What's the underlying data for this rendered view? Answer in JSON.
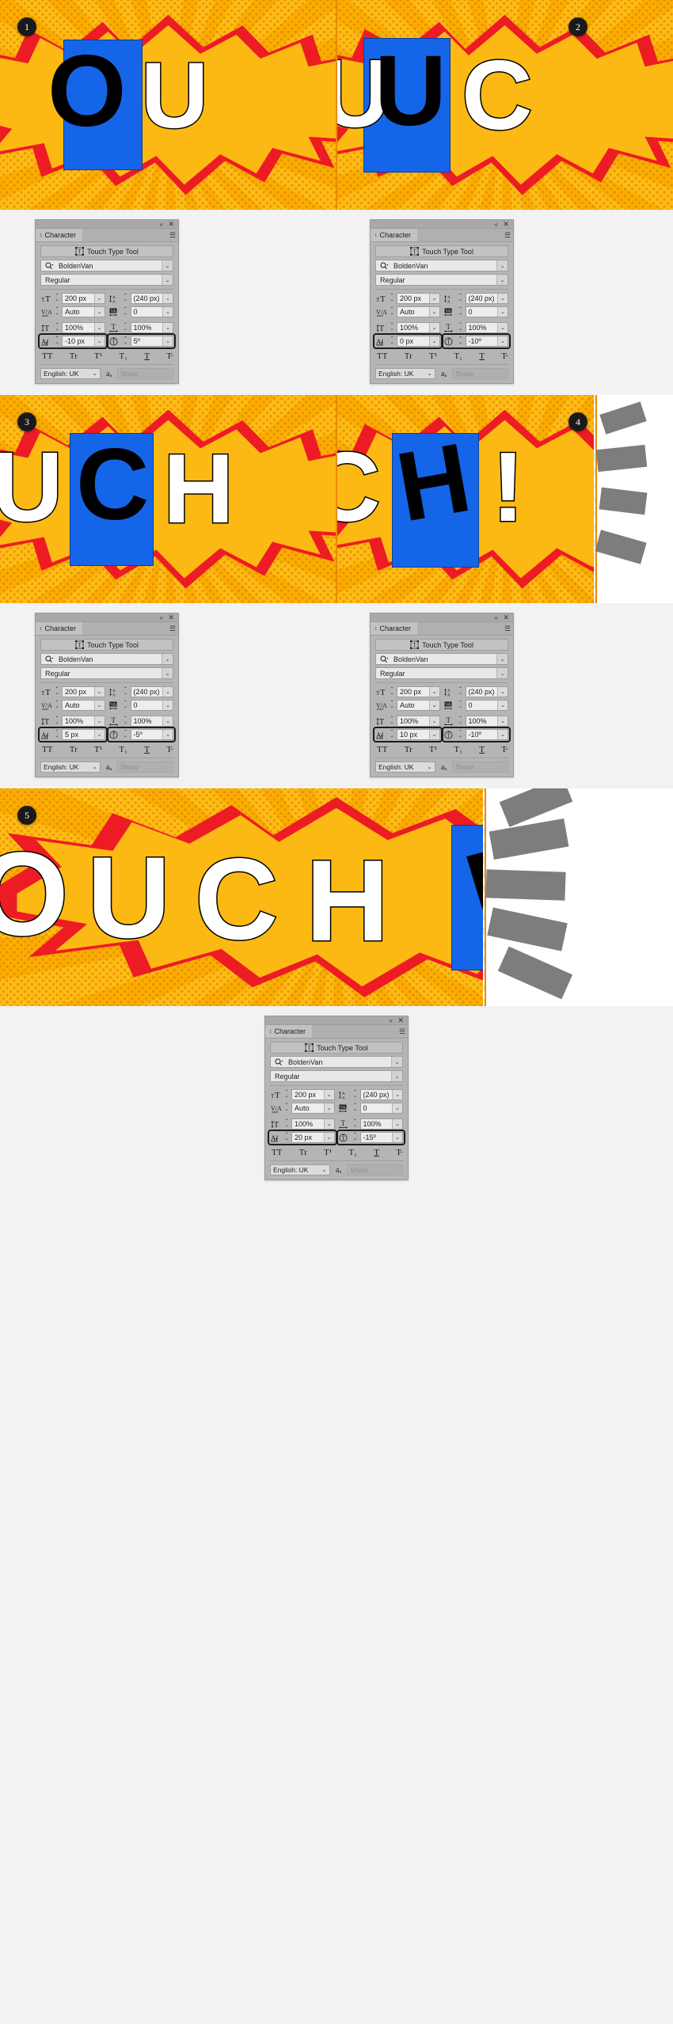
{
  "meta": {
    "app": "Adobe Illustrator — Character panel (Touch Type Tool tutorial)",
    "step_count": 5
  },
  "artwork": {
    "bg_color": "#FDB913",
    "burst_color": "#ED1C24",
    "box_color": "#1565E8",
    "steps": [
      {
        "badge": "1",
        "letters": "OU",
        "note": "letter O selected, black fill"
      },
      {
        "badge": "2",
        "letters": "UC",
        "note": "letter U selected, black fill"
      },
      {
        "badge": "3",
        "letters": "UCH",
        "note": "letter C selected, black fill"
      },
      {
        "badge": "4",
        "letters": "CH!",
        "note": "letter H selected, black fill"
      },
      {
        "badge": "5",
        "letters": "OUCH!",
        "note": "exclamation mark selected, black fill"
      }
    ]
  },
  "panel": {
    "title": "Character",
    "topbar": {
      "collapse_icon": "«",
      "close_icon": "✕"
    },
    "menu_icon": "☰",
    "tab_arrows_icon": "↕",
    "touch_type_tool": "Touch Type Tool",
    "font_family": "BoldenVan",
    "font_style": "Regular",
    "labels": {
      "font_size_icon": "font-size-icon",
      "leading_icon": "leading-icon",
      "kerning_icon": "kerning-icon",
      "tracking_icon": "tracking-icon",
      "vertical_scale_icon": "vertical-scale-icon",
      "horizontal_scale_icon": "horizontal-scale-icon",
      "baseline_shift_icon": "baseline-shift-icon",
      "character_rotation_icon": "character-rotation-icon"
    },
    "style_glyphs": [
      "TT",
      "Tr",
      "T¹",
      "T₁",
      "T",
      "T̵"
    ],
    "language": "English: UK",
    "antialias_icon": "aₐ",
    "antialias": "Sharp",
    "common": {
      "font_size": "200 px",
      "leading": "(240 px)",
      "kerning": "Auto",
      "tracking": "0",
      "vertical_scale": "100%",
      "horizontal_scale": "100%"
    }
  },
  "steps": [
    {
      "id": "1",
      "baseline_shift": "-10 px",
      "rotation": "5º",
      "highlight": [
        "baseline_shift",
        "rotation"
      ]
    },
    {
      "id": "2",
      "baseline_shift": "0 px",
      "rotation": "-10º",
      "highlight": [
        "baseline_shift",
        "rotation"
      ]
    },
    {
      "id": "3",
      "baseline_shift": "5 px",
      "rotation": "-5º",
      "highlight": [
        "baseline_shift",
        "rotation"
      ]
    },
    {
      "id": "4",
      "baseline_shift": "10 px",
      "rotation": "-10º",
      "highlight": [
        "baseline_shift",
        "rotation"
      ]
    },
    {
      "id": "5",
      "baseline_shift": "20 px",
      "rotation": "-15º",
      "highlight": [
        "baseline_shift",
        "rotation"
      ]
    }
  ]
}
